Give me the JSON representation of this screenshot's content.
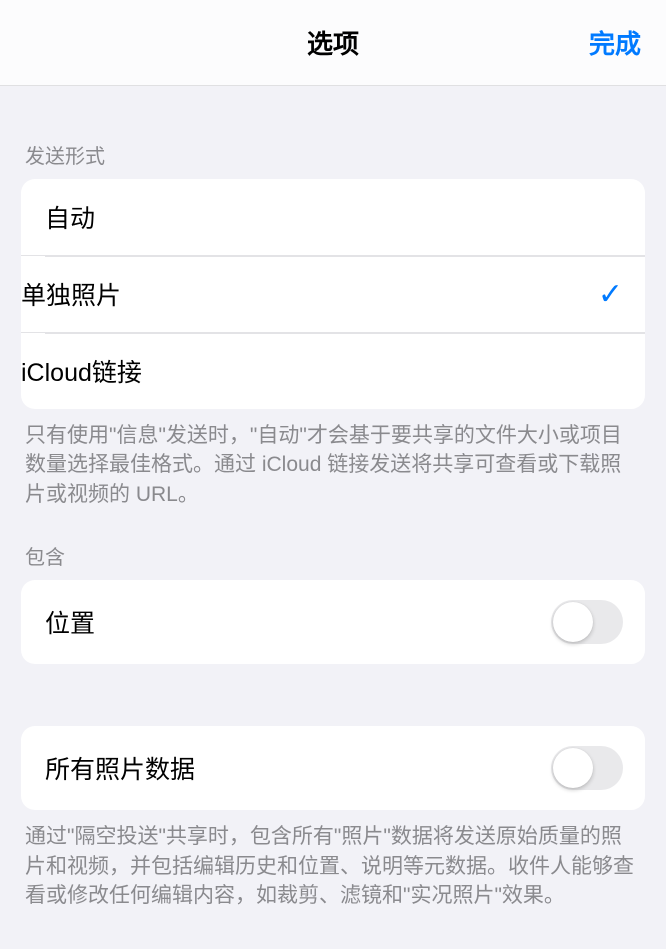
{
  "header": {
    "title": "选项",
    "done": "完成"
  },
  "send_section": {
    "header": "发送形式",
    "options": {
      "auto": "自动",
      "individual": "单独照片",
      "icloud": "iCloud链接"
    },
    "footer": "只有使用\"信息\"发送时，\"自动\"才会基于要共享的文件大小或项目数量选择最佳格式。通过 iCloud 链接发送将共享可查看或下载照片或视频的 URL。"
  },
  "include_section": {
    "header": "包含",
    "location": "位置",
    "all_data": "所有照片数据",
    "footer": "通过\"隔空投送\"共享时，包含所有\"照片\"数据将发送原始质量的照片和视频，并包括编辑历史和位置、说明等元数据。收件人能够查看或修改任何编辑内容，如裁剪、滤镜和\"实况照片\"效果。"
  }
}
